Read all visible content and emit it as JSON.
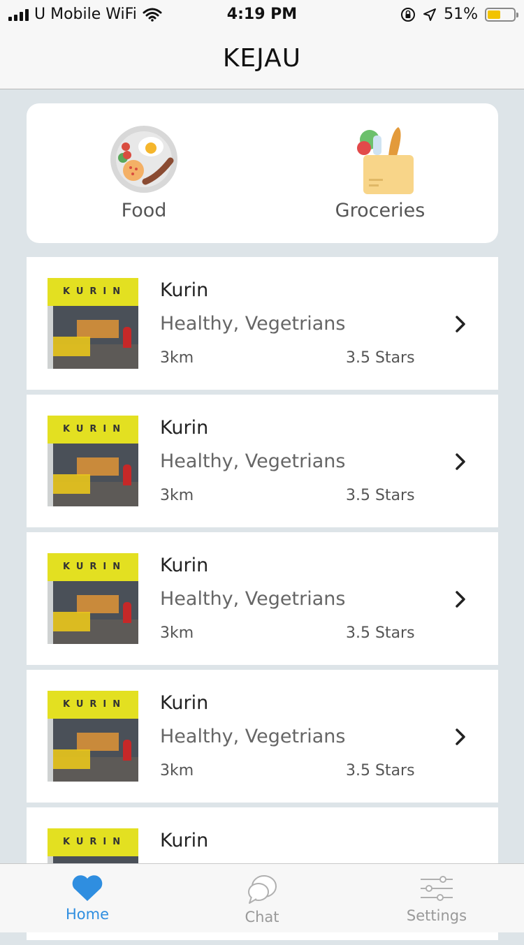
{
  "status_bar": {
    "carrier": "U Mobile WiFi",
    "time": "4:19 PM",
    "battery_percent": "51%",
    "battery_level": 0.51,
    "battery_color": "#f2c300"
  },
  "header": {
    "title": "KEJAU"
  },
  "categories": [
    {
      "label": "Food",
      "icon": "food-plate-icon"
    },
    {
      "label": "Groceries",
      "icon": "grocery-bag-icon"
    }
  ],
  "restaurants": [
    {
      "name": "Kurin",
      "tags": "Healthy, Vegetrians",
      "distance": "3km",
      "rating": "3.5 Stars",
      "sign_text": "KURIN"
    },
    {
      "name": "Kurin",
      "tags": "Healthy, Vegetrians",
      "distance": "3km",
      "rating": "3.5 Stars",
      "sign_text": "KURIN"
    },
    {
      "name": "Kurin",
      "tags": "Healthy, Vegetrians",
      "distance": "3km",
      "rating": "3.5 Stars",
      "sign_text": "KURIN"
    },
    {
      "name": "Kurin",
      "tags": "Healthy, Vegetrians",
      "distance": "3km",
      "rating": "3.5 Stars",
      "sign_text": "KURIN"
    },
    {
      "name": "Kurin",
      "tags": "",
      "distance": "",
      "rating": "",
      "sign_text": "KURIN"
    }
  ],
  "tab_bar": {
    "active_color": "#2f8ee0",
    "tabs": [
      {
        "label": "Home",
        "icon": "heart-icon",
        "active": true
      },
      {
        "label": "Chat",
        "icon": "chat-bubbles-icon",
        "active": false
      },
      {
        "label": "Settings",
        "icon": "sliders-icon",
        "active": false
      }
    ]
  }
}
